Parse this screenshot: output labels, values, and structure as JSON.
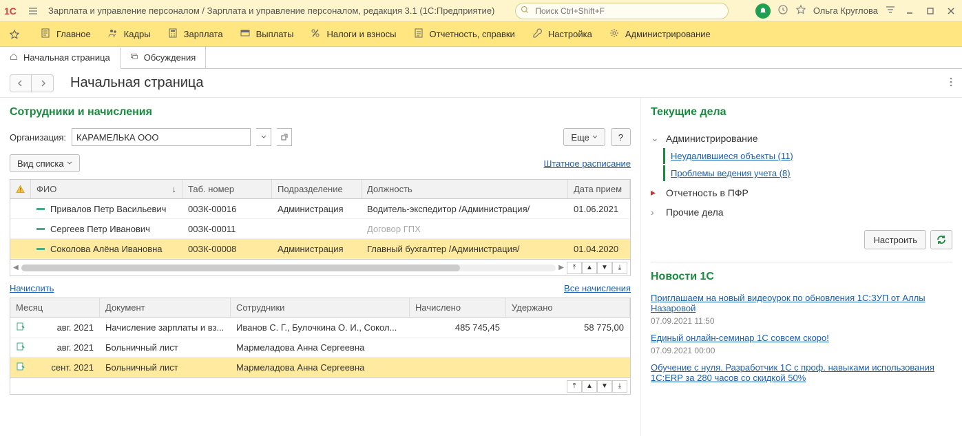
{
  "titlebar": {
    "title": "Зарплата и управление персоналом / Зарплата и управление персоналом, редакция 3.1  (1С:Предприятие)",
    "search_placeholder": "Поиск Ctrl+Shift+F",
    "user_name": "Ольга Круглова"
  },
  "mainmenu": {
    "items": [
      "Главное",
      "Кадры",
      "Зарплата",
      "Выплаты",
      "Налоги и взносы",
      "Отчетность, справки",
      "Настройка",
      "Администрирование"
    ]
  },
  "tabs": {
    "t0": "Начальная страница",
    "t1": "Обсуждения"
  },
  "page": {
    "title": "Начальная страница"
  },
  "employees": {
    "section_title": "Сотрудники и начисления",
    "org_label": "Организация:",
    "org_value": "КАРАМЕЛЬКА ООО",
    "more_btn": "Еще",
    "help_btn": "?",
    "view_list_btn": "Вид списка",
    "staffing_link": "Штатное расписание",
    "columns": {
      "fio": "ФИО",
      "tab": "Таб. номер",
      "dept": "Подразделение",
      "pos": "Должность",
      "date": "Дата прием"
    },
    "rows": [
      {
        "fio": "Привалов Петр Васильевич",
        "tab": "00ЗК-00016",
        "dept": "Администрация",
        "pos": "Водитель-экспедитор /Администрация/",
        "date": "01.06.2021"
      },
      {
        "fio": "Сергеев Петр Иванович",
        "tab": "00ЗК-00011",
        "dept": "",
        "pos": "Договор ГПХ",
        "pos_muted": true,
        "date": ""
      },
      {
        "fio": "Соколова Алёна Ивановна",
        "tab": "00ЗК-00008",
        "dept": "Администрация",
        "pos": "Главный бухгалтер /Администрация/",
        "date": "01.04.2020",
        "selected": true
      }
    ],
    "accrue_link": "Начислить",
    "all_accruals_link": "Все начисления"
  },
  "accruals": {
    "columns": {
      "month": "Месяц",
      "doc": "Документ",
      "emp": "Сотрудники",
      "accrued": "Начислено",
      "withheld": "Удержано"
    },
    "rows": [
      {
        "month": "авг. 2021",
        "doc": "Начисление зарплаты и вз...",
        "emp": "Иванов С. Г., Булочкина О. И., Сокол...",
        "accrued": "485 745,45",
        "withheld": "58 775,00"
      },
      {
        "month": "авг. 2021",
        "doc": "Больничный лист",
        "emp": "Мармеладова Анна Сергеевна",
        "accrued": "",
        "withheld": ""
      },
      {
        "month": "сент. 2021",
        "doc": "Больничный лист",
        "emp": "Мармеладова Анна Сергеевна",
        "accrued": "",
        "withheld": "",
        "selected": true
      }
    ]
  },
  "tasks": {
    "title": "Текущие дела",
    "items": {
      "admin": "Администрирование",
      "sub1": "Неудалившиеся объекты (11)",
      "sub2": "Проблемы ведения учета (8)",
      "pfr": "Отчетность в ПФР",
      "other": "Прочие дела"
    },
    "configure_btn": "Настроить"
  },
  "news": {
    "title": "Новости 1С",
    "items": [
      {
        "text": "Приглашаем на новый видеоурок по обновления 1С:ЗУП от Аллы Назаровой",
        "date": "07.09.2021 11:50"
      },
      {
        "text": "Единый онлайн-семинар 1С совсем скоро!",
        "date": "07.09.2021 00:00"
      },
      {
        "text": "Обучение с нуля. Разработчик 1С с проф. навыками использования 1С:ERP за 280 часов со скидкой 50%",
        "date": ""
      }
    ]
  }
}
